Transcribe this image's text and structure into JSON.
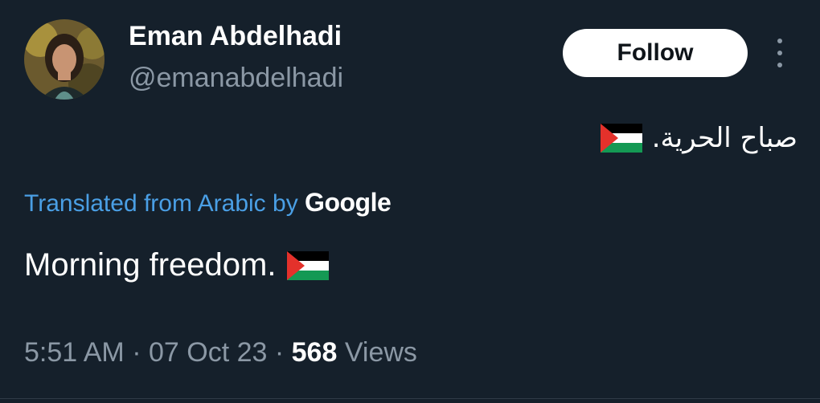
{
  "author": {
    "display_name": "Eman Abdelhadi",
    "handle": "@emanabdelhadi"
  },
  "follow_label": "Follow",
  "tweet": {
    "original_text": "صباح الحرية.",
    "translation_label": "Translated from Arabic by",
    "translation_provider": "Google",
    "translated_text": "Morning freedom.",
    "flag_icon": "palestine-flag-icon"
  },
  "meta": {
    "time": "5:51 AM",
    "separator": "·",
    "date": "07 Oct 23",
    "views_count": "568",
    "views_label": "Views"
  },
  "colors": {
    "background": "#15202b",
    "link": "#4a9fe5",
    "secondary_text": "#8b98a5",
    "primary_text": "#ffffff"
  }
}
